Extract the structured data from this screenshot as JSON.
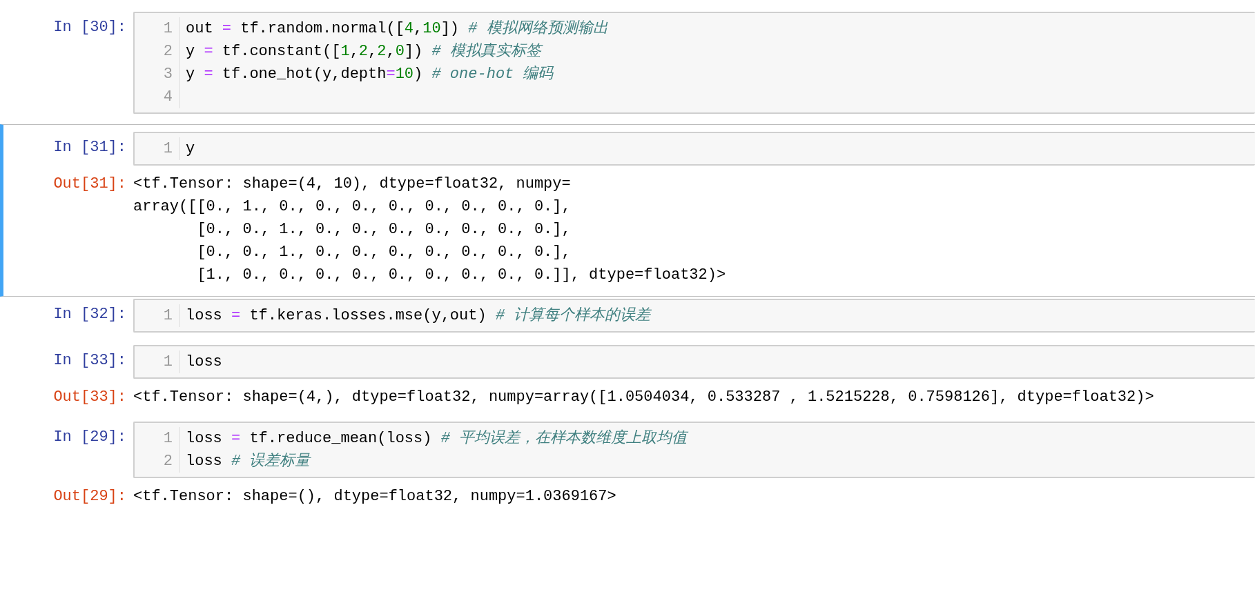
{
  "cells": [
    {
      "prompt": "In [30]:",
      "selected": false,
      "code": [
        {
          "number": "1",
          "tokens": [
            {
              "kind": "plain",
              "text": "out "
            },
            {
              "kind": "op",
              "text": "="
            },
            {
              "kind": "plain",
              "text": " tf.random.normal(["
            },
            {
              "kind": "num",
              "text": "4"
            },
            {
              "kind": "plain",
              "text": ","
            },
            {
              "kind": "num",
              "text": "10"
            },
            {
              "kind": "plain",
              "text": "]) "
            },
            {
              "kind": "comment",
              "text": "# 模拟网络预测输出"
            }
          ]
        },
        {
          "number": "2",
          "tokens": [
            {
              "kind": "plain",
              "text": "y "
            },
            {
              "kind": "op",
              "text": "="
            },
            {
              "kind": "plain",
              "text": " tf.constant(["
            },
            {
              "kind": "num",
              "text": "1"
            },
            {
              "kind": "plain",
              "text": ","
            },
            {
              "kind": "num",
              "text": "2"
            },
            {
              "kind": "plain",
              "text": ","
            },
            {
              "kind": "num",
              "text": "2"
            },
            {
              "kind": "plain",
              "text": ","
            },
            {
              "kind": "num",
              "text": "0"
            },
            {
              "kind": "plain",
              "text": "]) "
            },
            {
              "kind": "comment",
              "text": "# 模拟真实标签"
            }
          ]
        },
        {
          "number": "3",
          "tokens": [
            {
              "kind": "plain",
              "text": "y "
            },
            {
              "kind": "op",
              "text": "="
            },
            {
              "kind": "plain",
              "text": " tf.one_hot(y,depth"
            },
            {
              "kind": "op",
              "text": "="
            },
            {
              "kind": "num",
              "text": "10"
            },
            {
              "kind": "plain",
              "text": ") "
            },
            {
              "kind": "comment",
              "text": "# one-hot 编码"
            }
          ]
        },
        {
          "number": "4"
        }
      ]
    },
    {
      "prompt": "In [31]:",
      "selected": true,
      "code": [
        {
          "number": "1",
          "tokens": [
            {
              "kind": "plain",
              "text": "y"
            }
          ]
        }
      ],
      "output": {
        "prompt": "Out[31]:",
        "lines": [
          "<tf.Tensor: shape=(4, 10), dtype=float32, numpy=",
          "array([[0., 1., 0., 0., 0., 0., 0., 0., 0., 0.],",
          "       [0., 0., 1., 0., 0., 0., 0., 0., 0., 0.],",
          "       [0., 0., 1., 0., 0., 0., 0., 0., 0., 0.],",
          "       [1., 0., 0., 0., 0., 0., 0., 0., 0., 0.]], dtype=float32)>"
        ]
      }
    },
    {
      "prompt": "In [32]:",
      "selected": false,
      "code": [
        {
          "number": "1",
          "tokens": [
            {
              "kind": "plain",
              "text": "loss "
            },
            {
              "kind": "op",
              "text": "="
            },
            {
              "kind": "plain",
              "text": " tf.keras.losses.mse(y,out) "
            },
            {
              "kind": "comment",
              "text": "# 计算每个样本的误差"
            }
          ]
        }
      ]
    },
    {
      "prompt": "In [33]:",
      "selected": false,
      "code": [
        {
          "number": "1",
          "tokens": [
            {
              "kind": "plain",
              "text": "loss"
            }
          ]
        }
      ],
      "output": {
        "prompt": "Out[33]:",
        "lines": [
          "<tf.Tensor: shape=(4,), dtype=float32, numpy=array([1.0504034, 0.533287 , 1.5215228, 0.7598126], dtype=float32)>"
        ]
      }
    },
    {
      "prompt": "In [29]:",
      "selected": false,
      "code": [
        {
          "number": "1",
          "tokens": [
            {
              "kind": "plain",
              "text": "loss "
            },
            {
              "kind": "op",
              "text": "="
            },
            {
              "kind": "plain",
              "text": " tf.reduce_mean(loss) "
            },
            {
              "kind": "comment",
              "text": "# 平均误差，在样本数维度上取均值"
            }
          ]
        },
        {
          "number": "2",
          "tokens": [
            {
              "kind": "plain",
              "text": "loss "
            },
            {
              "kind": "comment",
              "text": "# 误差标量"
            }
          ]
        }
      ],
      "output": {
        "prompt": "Out[29]:",
        "lines": [
          "<tf.Tensor: shape=(), dtype=float32, numpy=1.0369167>"
        ]
      }
    }
  ]
}
